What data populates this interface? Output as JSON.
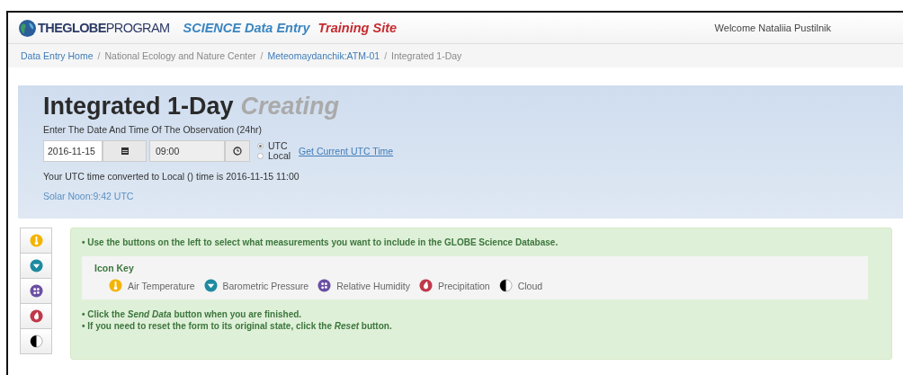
{
  "navbar": {
    "brand": "**THEGLOBE**PROGRAM",
    "app_title": "SCIENCE Data Entry",
    "site_label": "Training Site",
    "welcome": "Welcome Nataliia Pustilnik"
  },
  "breadcrumb": {
    "separator": "/",
    "items": [
      {
        "label": "Data Entry Home",
        "kind": "link"
      },
      {
        "label": "National Ecology and Nature Center",
        "kind": "text"
      },
      {
        "label": "Meteomaydanchik:ATM-01",
        "kind": "link"
      },
      {
        "label": "Integrated 1-Day",
        "kind": "text"
      }
    ]
  },
  "header": {
    "title": "Integrated 1-Day",
    "status": "Creating",
    "prompt": "Enter The Date And Time Of The Observation (24hr)",
    "date": "2016-11-15",
    "time": "09:00",
    "timezones": [
      {
        "label": "UTC",
        "selected": true
      },
      {
        "label": "Local",
        "selected": false
      }
    ],
    "utc_link": "Get Current UTC Time",
    "conversion": "Your UTC time converted to Local () time is 2016-11-15 11:00",
    "solar_noon": "Solar Noon:9:42 UTC"
  },
  "measurement_buttons": [
    {
      "kind": "air-temperature"
    },
    {
      "kind": "barometric-pressure"
    },
    {
      "kind": "relative-humidity"
    },
    {
      "kind": "precipitation"
    },
    {
      "kind": "cloud"
    }
  ],
  "instructions": {
    "intro": "• Use the buttons on the left to select what measurements you want to include in the GLOBE Science Database.",
    "icon_key_title": "Icon Key",
    "icon_key": [
      {
        "kind": "air-temperature",
        "label": "Air Temperature"
      },
      {
        "kind": "barometric-pressure",
        "label": "Barometric Pressure"
      },
      {
        "kind": "relative-humidity",
        "label": "Relative Humidity"
      },
      {
        "kind": "precipitation",
        "label": "Precipitation"
      },
      {
        "kind": "cloud",
        "label": "Cloud"
      }
    ],
    "notes": [
      "• Click the *Send Data* button when you are finished.",
      "• If you need to reset the form to its original state, click the *Reset* button."
    ]
  }
}
